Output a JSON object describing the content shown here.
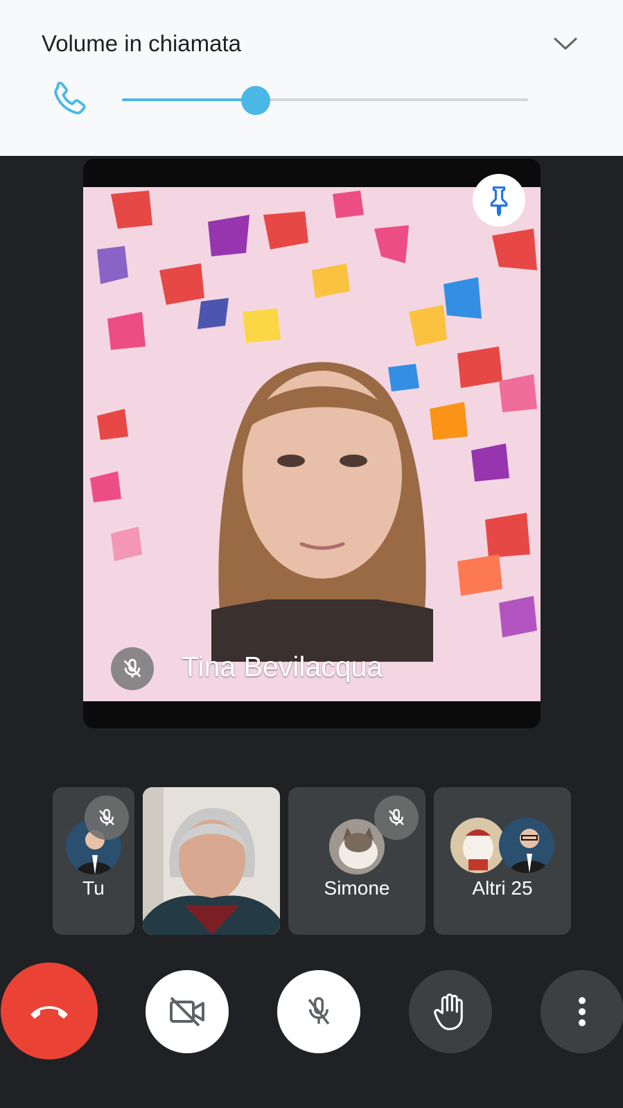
{
  "volume_panel": {
    "title": "Volume in chiamata",
    "level_percent": 33,
    "accent_color": "#4ab8e6",
    "icons": [
      "phone-icon",
      "chevron-down-icon"
    ]
  },
  "main_tile": {
    "participant_name": "Tina Bevilacqua",
    "muted": true,
    "icons": [
      "pin-icon",
      "mic-off-icon"
    ],
    "pin_color": "#1a73e8"
  },
  "participants": [
    {
      "label": "Tu",
      "muted": true
    },
    {
      "label": "",
      "muted": false
    },
    {
      "label": "Simone",
      "muted": true
    },
    {
      "label": "Altri 25",
      "muted": false
    }
  ],
  "controls": {
    "end_call_color": "#ea4335",
    "icons": [
      "end-call-icon",
      "camera-off-icon",
      "mic-off-icon",
      "raise-hand-icon",
      "more-options-icon"
    ]
  }
}
